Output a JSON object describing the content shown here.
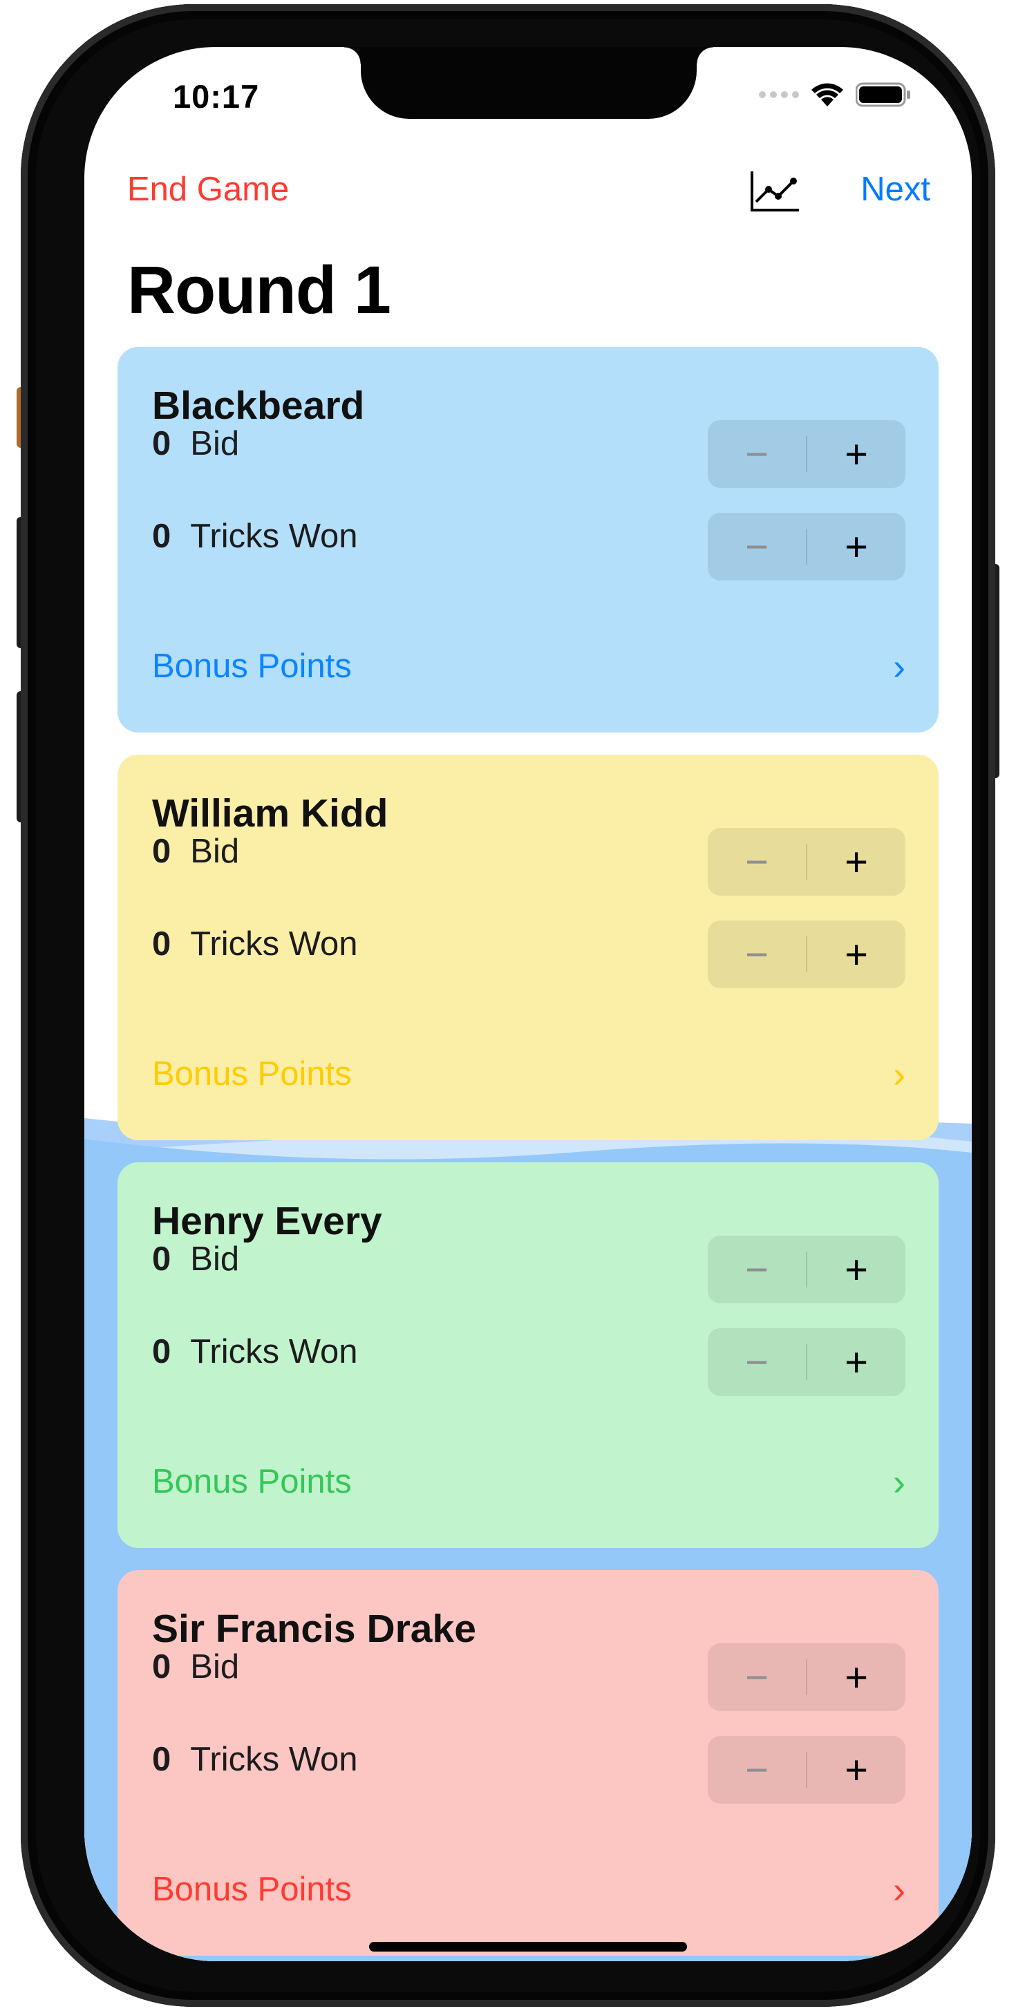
{
  "status_bar": {
    "time": "10:17"
  },
  "nav": {
    "end_game_label": "End Game",
    "chart_icon": "chart-line-icon",
    "next_label": "Next"
  },
  "title": "Round 1",
  "players": [
    {
      "name": "Blackbeard",
      "bid": "0",
      "bid_label": "Bid",
      "tricks": "0",
      "tricks_label": "Tricks Won",
      "bonus_label": "Bonus Points",
      "chevron": "›",
      "color": "#b3dffb",
      "stepper_bg": "#a2cbe6",
      "accent": "#0a84ff"
    },
    {
      "name": "William Kidd",
      "bid": "0",
      "bid_label": "Bid",
      "tricks": "0",
      "tricks_label": "Tricks Won",
      "bonus_label": "Bonus Points",
      "chevron": "›",
      "color": "#fbeea7",
      "stepper_bg": "#e8dc9b",
      "accent": "#ffcc00"
    },
    {
      "name": "Henry Every",
      "bid": "0",
      "bid_label": "Bid",
      "tricks": "0",
      "tricks_label": "Tricks Won",
      "bonus_label": "Bonus Points",
      "chevron": "›",
      "color": "#c1f4cc",
      "stepper_bg": "#b1e1bd",
      "accent": "#34c759"
    },
    {
      "name": "Sir Francis Drake",
      "bid": "0",
      "bid_label": "Bid",
      "tricks": "0",
      "tricks_label": "Tricks Won",
      "bonus_label": "Bonus Points",
      "chevron": "›",
      "color": "#fcc6c3",
      "stepper_bg": "#e8b7b4",
      "accent": "#ff3b30"
    }
  ],
  "stepper": {
    "minus": "−",
    "plus": "+"
  }
}
